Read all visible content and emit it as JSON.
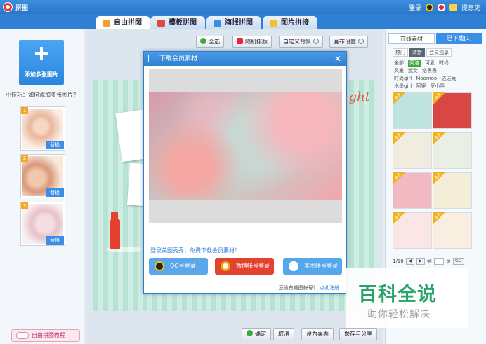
{
  "app": {
    "title": "拼图"
  },
  "titlebar": {
    "login": "登录",
    "notice": "提意见"
  },
  "tabs": [
    {
      "label": "自由拼图",
      "color": "#f0a030"
    },
    {
      "label": "模板拼图",
      "color": "#e24a3a"
    },
    {
      "label": "海报拼图",
      "color": "#3a8ee6"
    },
    {
      "label": "图片拼接",
      "color": "#f2c030"
    }
  ],
  "left": {
    "add_label": "添加多张图片",
    "tip": "小技巧：如何添加多张图片？",
    "thumbs": [
      {
        "num": "1",
        "replace": "替换"
      },
      {
        "num": "2",
        "replace": "替换"
      },
      {
        "num": "3",
        "replace": "替换"
      }
    ],
    "tutorial": "自由拼图教程"
  },
  "toolbar": {
    "select_all": "全选",
    "random": "随机排版",
    "custom_bg": "自定义背景",
    "canvas_settings": "画布设置"
  },
  "canvas": {
    "title_text": "ght"
  },
  "bottom": {
    "confirm": "确定",
    "cancel": "取消",
    "set_desktop": "设为桌面",
    "save_share": "保存与分享"
  },
  "right": {
    "tab_online": "在线素材",
    "tab_downloaded": "已下载[1]",
    "chips": [
      "热门",
      "清新",
      "会员独享"
    ],
    "active_chip": 1,
    "tag_rows": [
      [
        "全部",
        "简洁",
        "可爱",
        "时尚"
      ],
      [
        "风景",
        "淑女",
        "络丢丢"
      ],
      [
        "时尚girl",
        "Moomoo",
        "达达兔"
      ],
      [
        "水墨girl",
        "阿狸",
        "罗小黑"
      ]
    ],
    "tile_badge": "会员",
    "tile_colors": [
      "#bfe3df",
      "#d94646",
      "#f1ece0",
      "#e9efe5",
      "#f3b9c2",
      "#f4eed8",
      "#fbe6e6",
      "#f8efe0"
    ],
    "pager": {
      "page": "1/10",
      "goto": "到",
      "unit": "页",
      "go": "GO"
    }
  },
  "modal": {
    "title": "下载会员素材",
    "prompt": "登录美图秀秀，免费下载会员素材！",
    "qq_login": "QQ号登录",
    "weibo_login": "微博帐号登录",
    "meitu_login": "美图帐号登录",
    "no_account": "还没有美图帐号？",
    "register": "点此注册"
  },
  "watermark": {
    "logo": "百科全说",
    "sub": "助你轻松解决"
  }
}
